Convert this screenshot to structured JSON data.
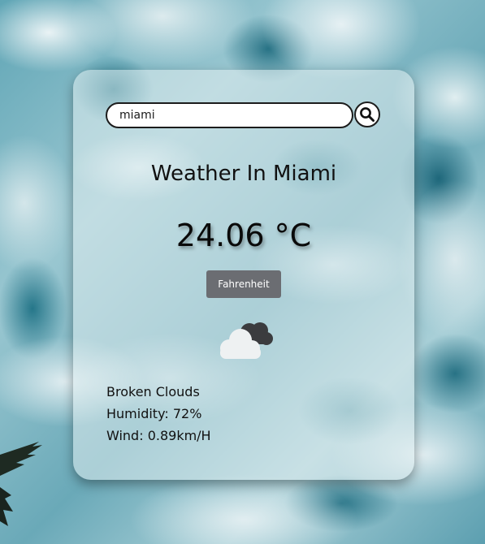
{
  "search": {
    "value": "miami",
    "button_icon": "search-icon"
  },
  "weather": {
    "title": "Weather In Miami",
    "temperature": "24.06 °C",
    "unit_toggle_label": "Fahrenheit",
    "icon": "broken-clouds-icon",
    "description": "Broken Clouds",
    "humidity": "Humidity: 72%",
    "wind": "Wind: 0.89km/H"
  },
  "colors": {
    "button_bg": "#6b6d72",
    "text": "#111111"
  }
}
